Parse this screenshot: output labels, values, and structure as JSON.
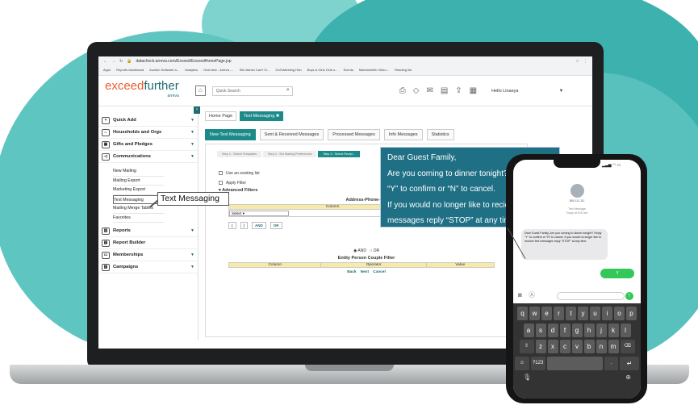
{
  "browser": {
    "url": "datacheck.arreva.com/Exceed/ExceedHomePage.jsp",
    "bookmarks": [
      "Apps",
      "Reports dashboard",
      "Auction Software a...",
      "Analytics",
      "Overview - Arreva -...",
      "Site Admin Can't Cl...",
      "GoToMeeting Hub",
      "Boys & Girls Club o...",
      "Events",
      "MaestroWeb Video...",
      "Reading list"
    ]
  },
  "app": {
    "logo_primary": "exceed",
    "logo_secondary": "further",
    "logo_sub": "arreva",
    "search_placeholder": "Quick Search",
    "greeting": "Hello Linaeya"
  },
  "sidebar": {
    "items": [
      {
        "label": "Quick Add",
        "icon": "plus-circle-icon"
      },
      {
        "label": "Households and Orgs",
        "icon": "household-icon"
      },
      {
        "label": "Gifts and Pledges",
        "icon": "gift-icon"
      },
      {
        "label": "Communications",
        "icon": "megaphone-icon"
      },
      {
        "label": "Reports",
        "icon": "chart-icon"
      },
      {
        "label": "Report Builder",
        "icon": "report-builder-icon"
      },
      {
        "label": "Memberships",
        "icon": "membership-card-icon"
      },
      {
        "label": "Campaigns",
        "icon": "campaign-icon"
      }
    ],
    "communications_sub": [
      "New Mailing",
      "Mailing Export",
      "Marketing Export",
      "Text Messaging",
      "Mailing Merge Tables",
      "Favorites"
    ]
  },
  "main": {
    "tabs": [
      "Home Page",
      "Text Messaging"
    ],
    "subtabs": [
      "New Text Messaging",
      "Sent & Received Messages",
      "Processed Messages",
      "Info Messages",
      "Statistics"
    ],
    "steps": [
      "Step 1 : Select Templates",
      "Step 2 : Set Mailing Preferences",
      "Step 3 : Select Recipi..."
    ],
    "option_existing_list": "Use an existing list",
    "option_apply_filter": "Apply Filter",
    "advanced_filters": "Advanced Filters",
    "filter_title": "Address-Phone-Em",
    "filter_cols": [
      "Column",
      "Operator"
    ],
    "select_value": "Select",
    "buttons": [
      "(",
      ")",
      "AND",
      "OR"
    ],
    "radio_and": "AND",
    "radio_or": "OR",
    "filter2_title": "Entity Person Couple Filter",
    "filter2_cols": [
      "Column",
      "Operator",
      "Value"
    ],
    "nav": [
      "Back",
      "Next",
      "Cancel"
    ]
  },
  "callouts": {
    "text_messaging": "Text Messaging",
    "message_lines": [
      "Dear Guest Family,",
      "Are you coming to dinner tonight? Reply",
      "“Y” to confirm or “N” to cancel.",
      "If you would no longer like to recieeve text",
      "messages reply “STOP” at any time."
    ]
  },
  "phone": {
    "contact": "555-111-111",
    "meta_title": "Text Message",
    "meta_time": "Today at 9:00 am",
    "message": "Dear Guest Family, Are you coming to dinner tonight? Reply \"Y\" to confirm or \"N\" to cancel. If you would no longer like to receive text messages reply \"STOP\" at any time.",
    "reply": "Y",
    "keyboard": {
      "row1": [
        "q",
        "w",
        "e",
        "r",
        "t",
        "y",
        "u",
        "i",
        "o",
        "p"
      ],
      "row2": [
        "a",
        "s",
        "d",
        "f",
        "g",
        "h",
        "j",
        "k",
        "l"
      ],
      "row3": [
        "z",
        "x",
        "c",
        "v",
        "b",
        "n",
        "m"
      ],
      "numkey": "?123"
    }
  }
}
